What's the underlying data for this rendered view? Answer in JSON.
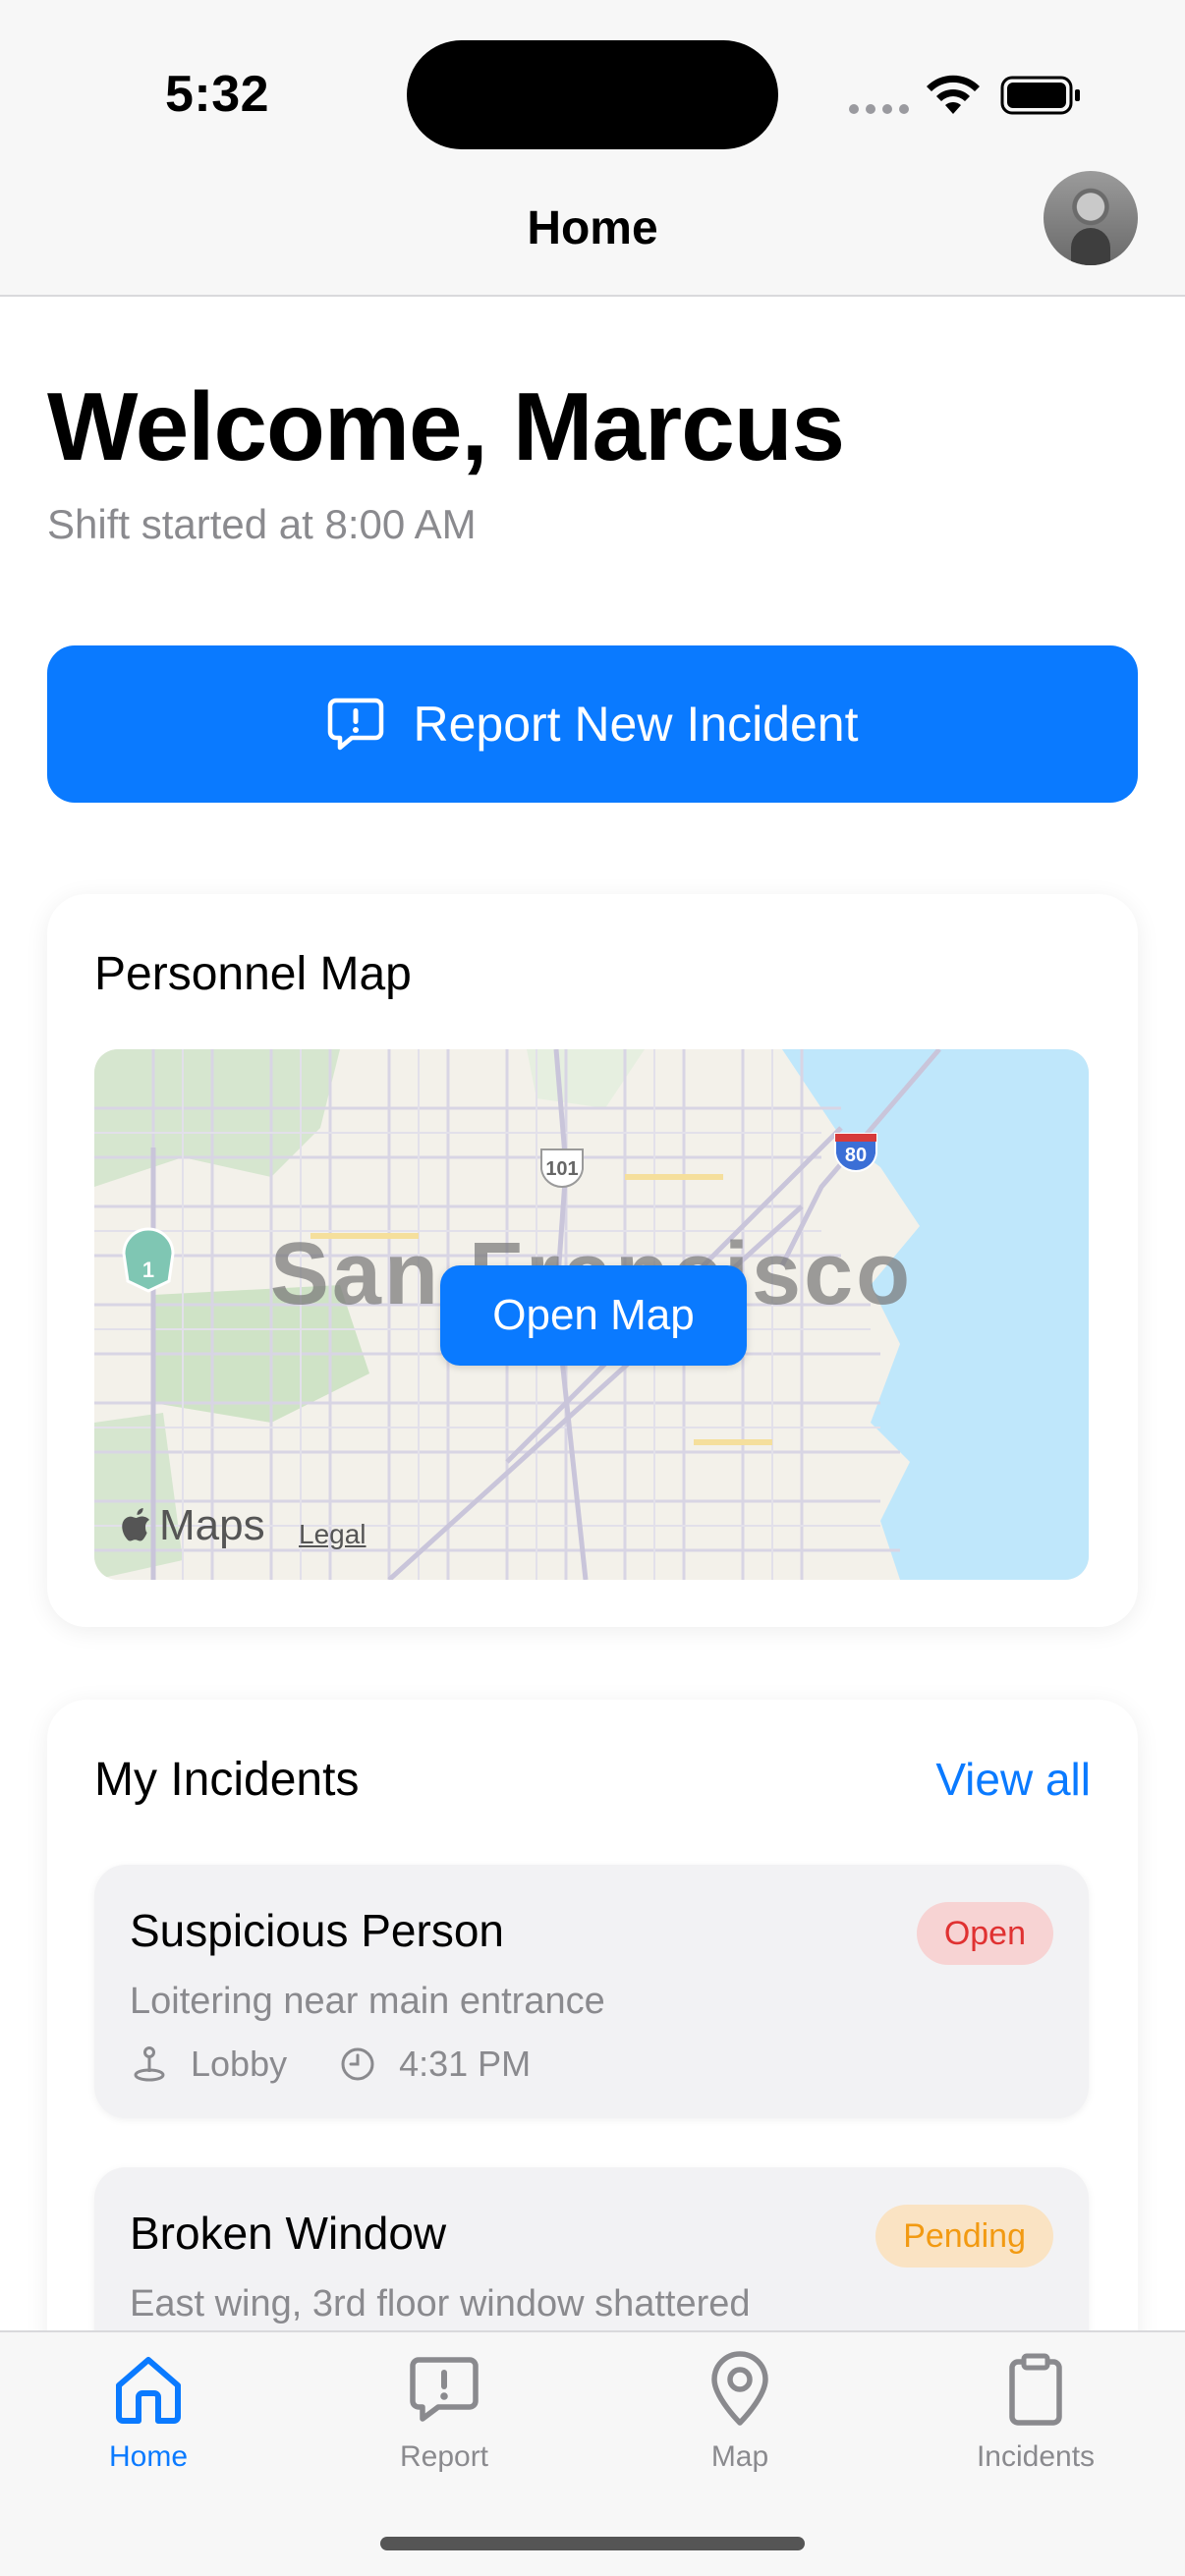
{
  "status_bar": {
    "time": "5:32"
  },
  "nav": {
    "title": "Home"
  },
  "welcome": {
    "title": "Welcome, Marcus",
    "subtitle": "Shift started at 8:00 AM"
  },
  "report_button": {
    "label": "Report New Incident",
    "icon": "exclamation-bubble-icon"
  },
  "map_card": {
    "title": "Personnel Map",
    "city_label": "San Francisco",
    "open_map_label": "Open Map",
    "maps_brand": "Maps",
    "legal_label": "Legal"
  },
  "incidents_card": {
    "title": "My Incidents",
    "view_all_label": "View all",
    "items": [
      {
        "title": "Suspicious Person",
        "status": "Open",
        "description": "Loitering near main entrance",
        "location": "Lobby",
        "time": "4:31 PM"
      },
      {
        "title": "Broken Window",
        "status": "Pending",
        "description": "East wing, 3rd floor window shattered"
      }
    ]
  },
  "tab_bar": {
    "tabs": [
      {
        "label": "Home",
        "icon": "house-icon",
        "active": true
      },
      {
        "label": "Report",
        "icon": "exclamation-bubble-icon",
        "active": false
      },
      {
        "label": "Map",
        "icon": "map-pin-icon",
        "active": false
      },
      {
        "label": "Incidents",
        "icon": "clipboard-icon",
        "active": false
      }
    ]
  },
  "colors": {
    "accent": "#0a7aff",
    "open_badge_bg": "#f7d3d3",
    "open_badge_text": "#e03131",
    "pending_badge_bg": "#fae3c3",
    "pending_badge_text": "#f29a12",
    "secondary_text": "#8a8a8e"
  }
}
